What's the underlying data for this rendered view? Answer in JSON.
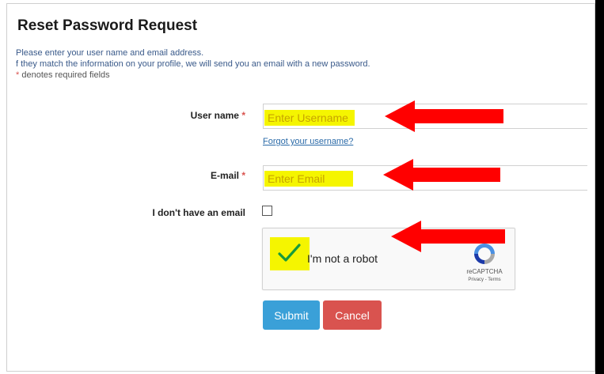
{
  "page": {
    "title": "Reset Password Request",
    "info_line1": "Please enter your user name and email address.",
    "info_line2": "f they match the information on your profile, we will send you an email with a new password.",
    "required_star": "*",
    "required_note": "denotes required fields"
  },
  "form": {
    "username": {
      "label": "User name",
      "placeholder": "Enter Username"
    },
    "forgot_username_link": "Forgot your username?",
    "email": {
      "label": "E-mail",
      "placeholder": "Enter Email"
    },
    "no_email": {
      "label": "I don't have an email",
      "checked": false
    },
    "captcha": {
      "label": "I'm not a robot",
      "brand": "reCAPTCHA",
      "terms": "Privacy - Terms",
      "checked": true
    },
    "submit_label": "Submit",
    "cancel_label": "Cancel"
  },
  "colors": {
    "highlight": "#f5f500",
    "arrow": "#ff0000",
    "submit": "#3aa0d8",
    "cancel": "#d9534f",
    "required": "#d9534f"
  }
}
